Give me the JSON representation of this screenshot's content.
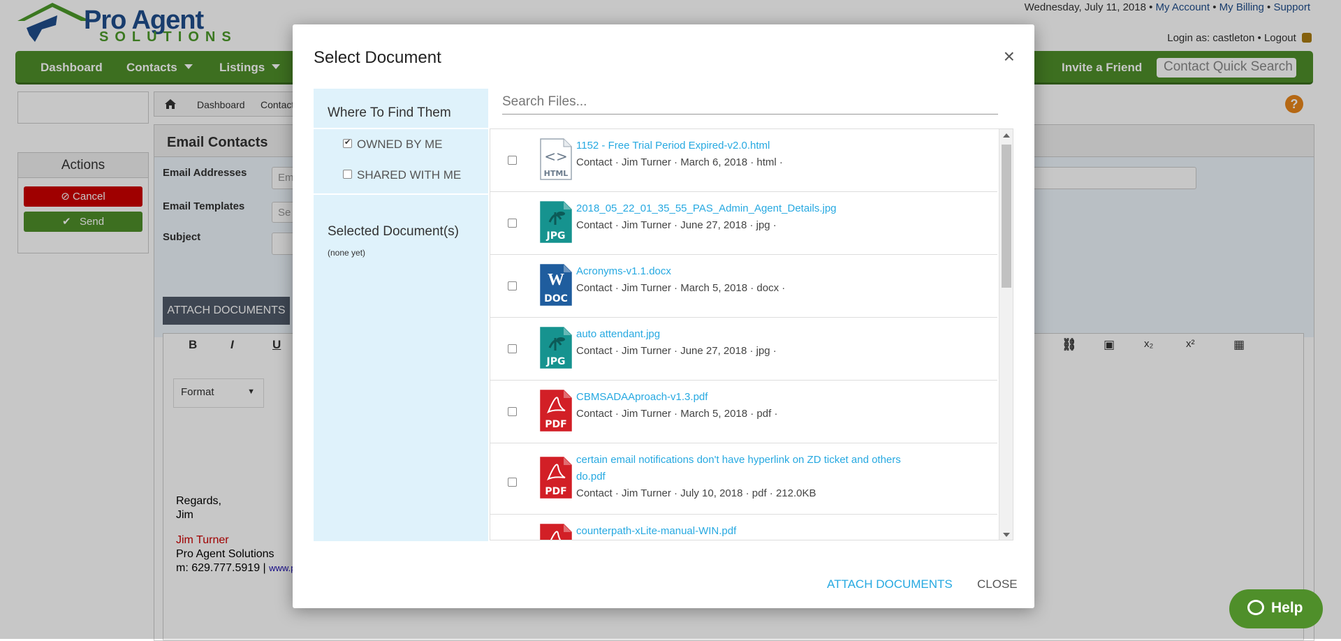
{
  "header": {
    "brand_line1": "Pro Agent",
    "brand_line2": "SOLUTIONS",
    "date": "Wednesday, July 11, 2018",
    "links": {
      "my_account": "My Account",
      "my_billing": "My Billing",
      "support": "Support"
    },
    "login_text": "Login as: castleton",
    "logout": "Logout"
  },
  "nav": {
    "dashboard": "Dashboard",
    "contacts": "Contacts",
    "listings": "Listings",
    "invite": "Invite a Friend",
    "quick_search": "Contact Quick Search"
  },
  "breadcrumb": {
    "item1": "Dashboard",
    "item2": "Contact"
  },
  "actions": {
    "title": "Actions",
    "cancel": "Cancel",
    "send": "Send"
  },
  "email_panel": {
    "title": "Email Contacts",
    "email_addresses_label": "Email Addresses",
    "email_addresses_placeholder": "Em",
    "email_templates_label": "Email Templates",
    "email_templates_placeholder": "Se",
    "subject_label": "Subject",
    "attach_button": "ATTACH DOCUMENTS",
    "toolbar": {
      "bold": "B",
      "italic": "I",
      "underline": "U",
      "format": "Format",
      "subscript": "x₂",
      "superscript": "x²"
    },
    "signature": {
      "regards": "Regards,",
      "first": "Jim",
      "name": "Jim Turner",
      "company": "Pro Agent Solutions",
      "phone": "m: 629.777.5919 |",
      "website": "www.p"
    }
  },
  "modal": {
    "title": "Select Document",
    "close_symbol": "×",
    "where_heading": "Where To Find Them",
    "owned_label": "OWNED BY ME",
    "owned_checked": true,
    "shared_label": "SHARED WITH ME",
    "shared_checked": false,
    "selected_heading": "Selected Document(s)",
    "selected_none": "(none yet)",
    "search_placeholder": "Search Files...",
    "files": [
      {
        "name": "1152 - Free Trial Period Expired-v2.0.html",
        "meta": "Contact · Jim Turner · March 6, 2018 · html ·",
        "type": "HTML",
        "icon": "html-file-icon",
        "color": "#ffffff"
      },
      {
        "name": "2018_05_22_01_35_55_PAS_Admin_Agent_Details.jpg",
        "meta": "Contact · Jim Turner · June 27, 2018 · jpg ·",
        "type": "JPG",
        "icon": "jpg-file-icon",
        "color": "#16938f"
      },
      {
        "name": "Acronyms-v1.1.docx",
        "meta": "Contact · Jim Turner · March 5, 2018 · docx ·",
        "type": "DOC",
        "icon": "doc-file-icon",
        "color": "#1f5d9e"
      },
      {
        "name": "auto attendant.jpg",
        "meta": "Contact · Jim Turner · June 27, 2018 · jpg ·",
        "type": "JPG",
        "icon": "jpg-file-icon",
        "color": "#16938f"
      },
      {
        "name": "CBMSADAAproach-v1.3.pdf",
        "meta": "Contact · Jim Turner · March 5, 2018 · pdf ·",
        "type": "PDF",
        "icon": "pdf-file-icon",
        "color": "#d21f26"
      },
      {
        "name": "certain email notifications don't have hyperlink on ZD ticket and others do.pdf",
        "meta": "Contact · Jim Turner · July 10, 2018 · pdf · 212.0KB",
        "type": "PDF",
        "icon": "pdf-file-icon",
        "color": "#d21f26"
      },
      {
        "name": "counterpath-xLite-manual-WIN.pdf",
        "meta": "",
        "type": "PDF",
        "icon": "pdf-file-icon",
        "color": "#d21f26"
      }
    ],
    "attach_label": "ATTACH DOCUMENTS",
    "close_label": "CLOSE"
  },
  "help": {
    "label": "Help"
  },
  "colors": {
    "nav_green": "#4f8f2a",
    "link_blue": "#27a9e1",
    "sidebar_blue": "#dff2fb",
    "cancel_red": "#cc0000"
  }
}
